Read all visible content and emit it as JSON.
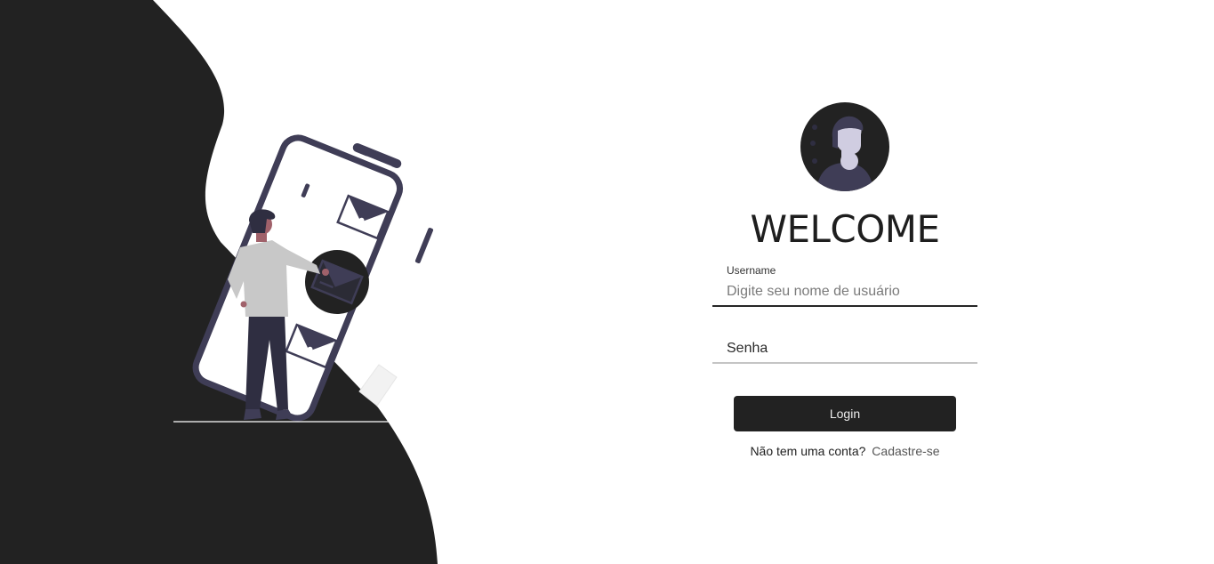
{
  "welcome": {
    "title": "WELCOME"
  },
  "form": {
    "username_label": "Username",
    "username_placeholder": "Digite seu nome de usuário",
    "password_placeholder": "Senha",
    "login_label": "Login",
    "signup_prompt": "Não tem uma conta?",
    "signup_link": "Cadastre-se"
  },
  "colors": {
    "dark": "#222222",
    "figure_dark": "#3f3d56",
    "figure_light": "#d0cde1",
    "accent_skin": "#a0616a"
  },
  "icons": [
    "user-avatar-icon",
    "envelope-icon"
  ]
}
